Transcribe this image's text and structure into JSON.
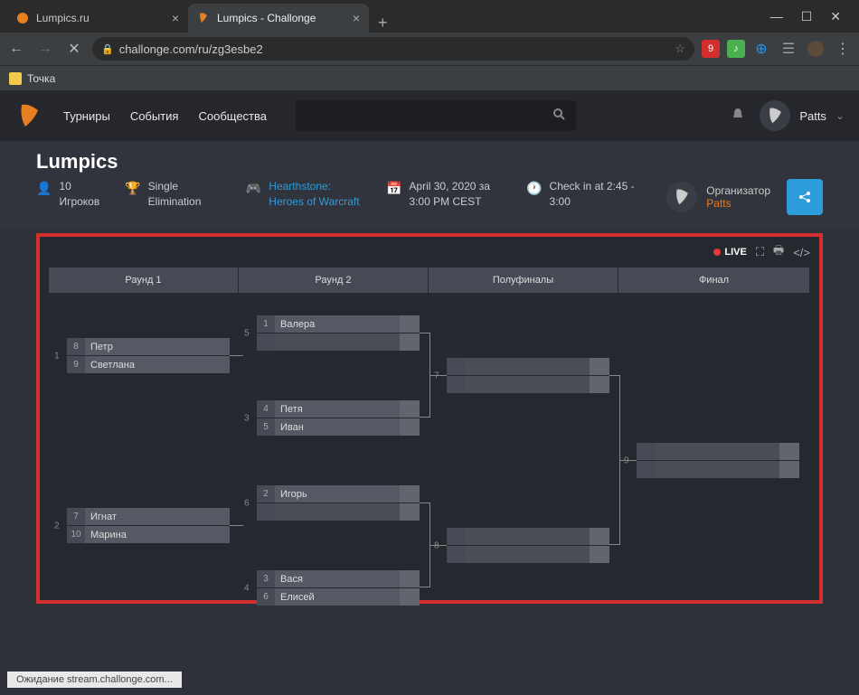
{
  "browser": {
    "tabs": [
      {
        "title": "Lumpics.ru",
        "active": false
      },
      {
        "title": "Lumpics - Challonge",
        "active": true
      }
    ],
    "url": "challonge.com/ru/zg3esbe2",
    "bookmark": "Точка",
    "status": "Ожидание stream.challonge.com..."
  },
  "header": {
    "nav": [
      "Турниры",
      "События",
      "Сообщества"
    ],
    "user": "Patts"
  },
  "tournament": {
    "title": "Lumpics",
    "players_count": "10",
    "players_label": "Игроков",
    "format": "Single Elimination",
    "game": "Hearthstone: Heroes of Warcraft",
    "date": "April 30, 2020 за 3:00 PM CEST",
    "checkin": "Check in at 2:45 - 3:00",
    "organizer_label": "Организатор",
    "organizer_name": "Patts"
  },
  "bracket": {
    "live": "LIVE",
    "rounds": [
      "Раунд 1",
      "Раунд 2",
      "Полуфиналы",
      "Финал"
    ],
    "matches": {
      "m1": {
        "num": "1",
        "p1_seed": "8",
        "p1_name": "Петр",
        "p2_seed": "9",
        "p2_name": "Светлана"
      },
      "m2": {
        "num": "2",
        "p1_seed": "7",
        "p1_name": "Игнат",
        "p2_seed": "10",
        "p2_name": "Марина"
      },
      "m3": {
        "num": "5",
        "p1_seed": "1",
        "p1_name": "Валера"
      },
      "m4": {
        "num": "3",
        "p1_seed": "4",
        "p1_name": "Петя",
        "p2_seed": "5",
        "p2_name": "Иван"
      },
      "m5": {
        "num": "6",
        "p1_seed": "2",
        "p1_name": "Игорь"
      },
      "m6": {
        "num": "4",
        "p1_seed": "3",
        "p1_name": "Вася",
        "p2_seed": "6",
        "p2_name": "Елисей"
      },
      "m7": {
        "num": "7"
      },
      "m8": {
        "num": "8"
      },
      "m9": {
        "num": "9"
      }
    }
  }
}
